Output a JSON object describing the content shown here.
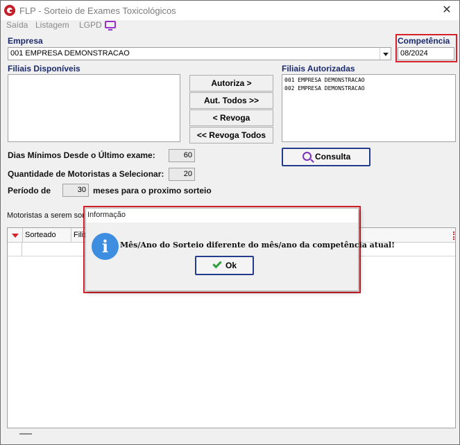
{
  "window": {
    "title": "FLP - Sorteio de Exames Toxicológicos",
    "close_glyph": "✕"
  },
  "menu": [
    {
      "label": "Saída"
    },
    {
      "label": "Listagem"
    },
    {
      "label": "LGPD"
    }
  ],
  "form": {
    "empresa_label": "Empresa",
    "empresa_value": "001 EMPRESA DEMONSTRACAO",
    "competencia_label": "Competência",
    "competencia_value": "08/2024",
    "filiais_disponiveis_label": "Filiais Disponíveis",
    "filiais_autorizadas_label": "Filiais Autorizadas",
    "filiais_autorizadas": [
      "001 EMPRESA DEMONSTRACAO",
      "002 EMPRESA DEMONSTRACAO"
    ],
    "buttons": {
      "autoriza": "Autoriza >",
      "aut_todos": "Aut. Todos >>",
      "revoga": "< Revoga",
      "revoga_todos": "<< Revoga Todos",
      "consulta": "Consulta"
    },
    "dias_minimos_label": "Dias Mínimos Desde o Último exame:",
    "dias_minimos_value": "60",
    "quantidade_label": "Quantidade de Motoristas a Selecionar:",
    "quantidade_value": "20",
    "periodo_label": "Período  de",
    "periodo_value": "30",
    "periodo_suffix": "meses  para o proximo sorteio"
  },
  "grid": {
    "section_label": "Motoristas a serem sor",
    "columns": [
      "Sorteado",
      "Filia"
    ]
  },
  "dialog": {
    "title": "Informação",
    "info_glyph": "i",
    "message": "Mês/Ano do Sorteio diferente do mês/ano da competência atual!",
    "ok_label": "Ok"
  },
  "colors": {
    "highlight_red": "#d8202a",
    "accent_navy": "#243a8a",
    "info_blue": "#3d8ee0",
    "label_navy": "#1a2a6c"
  }
}
